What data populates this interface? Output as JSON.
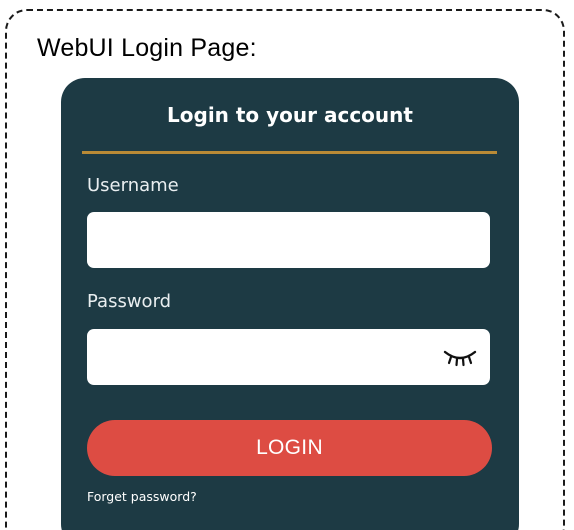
{
  "caption": "WebUI Login Page:",
  "login_form": {
    "title": "Login to your account",
    "username_label": "Username",
    "username_value": "",
    "password_label": "Password",
    "password_value": "",
    "password_toggle_icon": "closed-eye-icon",
    "login_button_label": "LOGIN",
    "forgot_password_label": "Forget password?"
  },
  "colors": {
    "card_background": "#1d3a44",
    "divider": "#b98a36",
    "login_button": "#dd4c43",
    "input_background": "#ffffff"
  }
}
